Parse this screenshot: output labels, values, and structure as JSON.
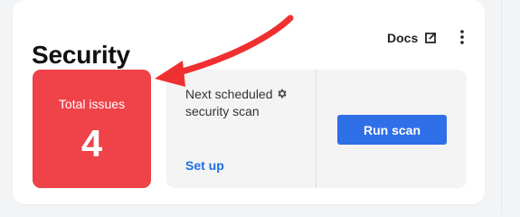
{
  "card": {
    "title": "Security",
    "docs_label": "Docs",
    "docs_icon": "external-link-icon",
    "menu_icon": "kebab-menu-icon"
  },
  "total_issues": {
    "label": "Total issues",
    "value": "4",
    "background_color": "#ef4349"
  },
  "scan": {
    "title_line_1": "Next scheduled",
    "title_line_2": "security scan",
    "title_icon": "gear-icon",
    "setup_label": "Set up",
    "run_button_label": "Run scan",
    "button_color": "#2f6fe8",
    "link_color": "#1f6fe5"
  },
  "annotation": {
    "arrow_color": "#ef3030",
    "arrow_icon": "red-arrow-icon"
  }
}
